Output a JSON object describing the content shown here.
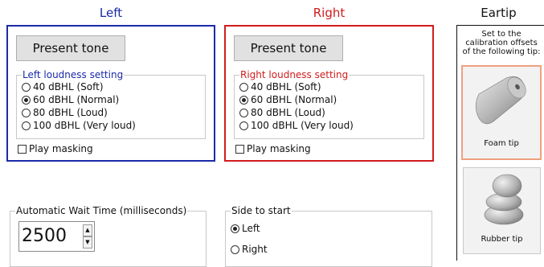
{
  "left": {
    "heading": "Left",
    "color": "#1a2aa8",
    "present_button": "Present tone",
    "loudness_legend": "Left loudness setting",
    "options": [
      "40 dBHL (Soft)",
      "60 dBHL (Normal)",
      "80 dBHL (Loud)",
      "100 dBHL (Very loud)"
    ],
    "selected_index": 1,
    "masking_label": "Play masking",
    "masking_checked": false
  },
  "right": {
    "heading": "Right",
    "color": "#d01c1c",
    "present_button": "Present tone",
    "loudness_legend": "Right loudness setting",
    "options": [
      "40 dBHL (Soft)",
      "60 dBHL (Normal)",
      "80 dBHL (Loud)",
      "100 dBHL (Very loud)"
    ],
    "selected_index": 1,
    "masking_label": "Play masking",
    "masking_checked": false
  },
  "eartip": {
    "heading": "Eartip",
    "caption": "Set to the calibration offsets of the following tip:",
    "tips": [
      {
        "label": "Foam tip",
        "icon": "foam-tip-icon",
        "selected": true
      },
      {
        "label": "Rubber tip",
        "icon": "rubber-tip-icon",
        "selected": false
      }
    ],
    "selected_border_color": "#f0a080"
  },
  "wait_time": {
    "legend": "Automatic Wait Time (milliseconds)",
    "value": "2500"
  },
  "side_to_start": {
    "legend": "Side to start",
    "options": [
      "Left",
      "Right"
    ],
    "selected_index": 0
  }
}
